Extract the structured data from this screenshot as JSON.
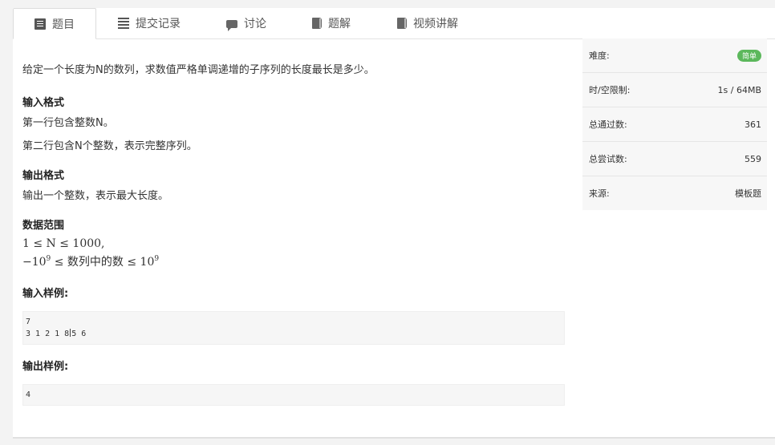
{
  "tabs": [
    {
      "label": "题目",
      "icon": "document-icon"
    },
    {
      "label": "提交记录",
      "icon": "list-icon"
    },
    {
      "label": "讨论",
      "icon": "chat-icon"
    },
    {
      "label": "题解",
      "icon": "book-icon"
    },
    {
      "label": "视频讲解",
      "icon": "video-book-icon"
    }
  ],
  "problem": {
    "description": "给定一个长度为N的数列，求数值严格单调递增的子序列的长度最长是多少。",
    "input_title": "输入格式",
    "input_line1": "第一行包含整数N。",
    "input_line2": "第二行包含N个整数，表示完整序列。",
    "output_title": "输出格式",
    "output_line": "输出一个整数，表示最大长度。",
    "range_title": "数据范围",
    "range_line1": "1 ≤ N ≤ 1000,",
    "range_line2_pre": "−10",
    "range_line2_exp": "9",
    "range_line2_mid": " ≤ 数列中的数 ≤ 10",
    "range_line2_exp2": "9",
    "sample_input_title": "输入样例:",
    "sample_input_line1": "7",
    "sample_input_line2a": "3 1 2 1 8",
    "sample_input_line2b": "5 6",
    "sample_output_title": "输出样例:",
    "sample_output": "4"
  },
  "info": {
    "difficulty_label": "难度:",
    "difficulty_value": "简单",
    "limit_label": "时/空限制:",
    "limit_value": "1s / 64MB",
    "passed_label": "总通过数:",
    "passed_value": "361",
    "tried_label": "总尝试数:",
    "tried_value": "559",
    "source_label": "来源:",
    "source_value": "模板题"
  },
  "colors": {
    "badge": "#5cb85c",
    "sidebar_bg": "#f7f7f7",
    "page_bg": "#f3f3f3"
  }
}
